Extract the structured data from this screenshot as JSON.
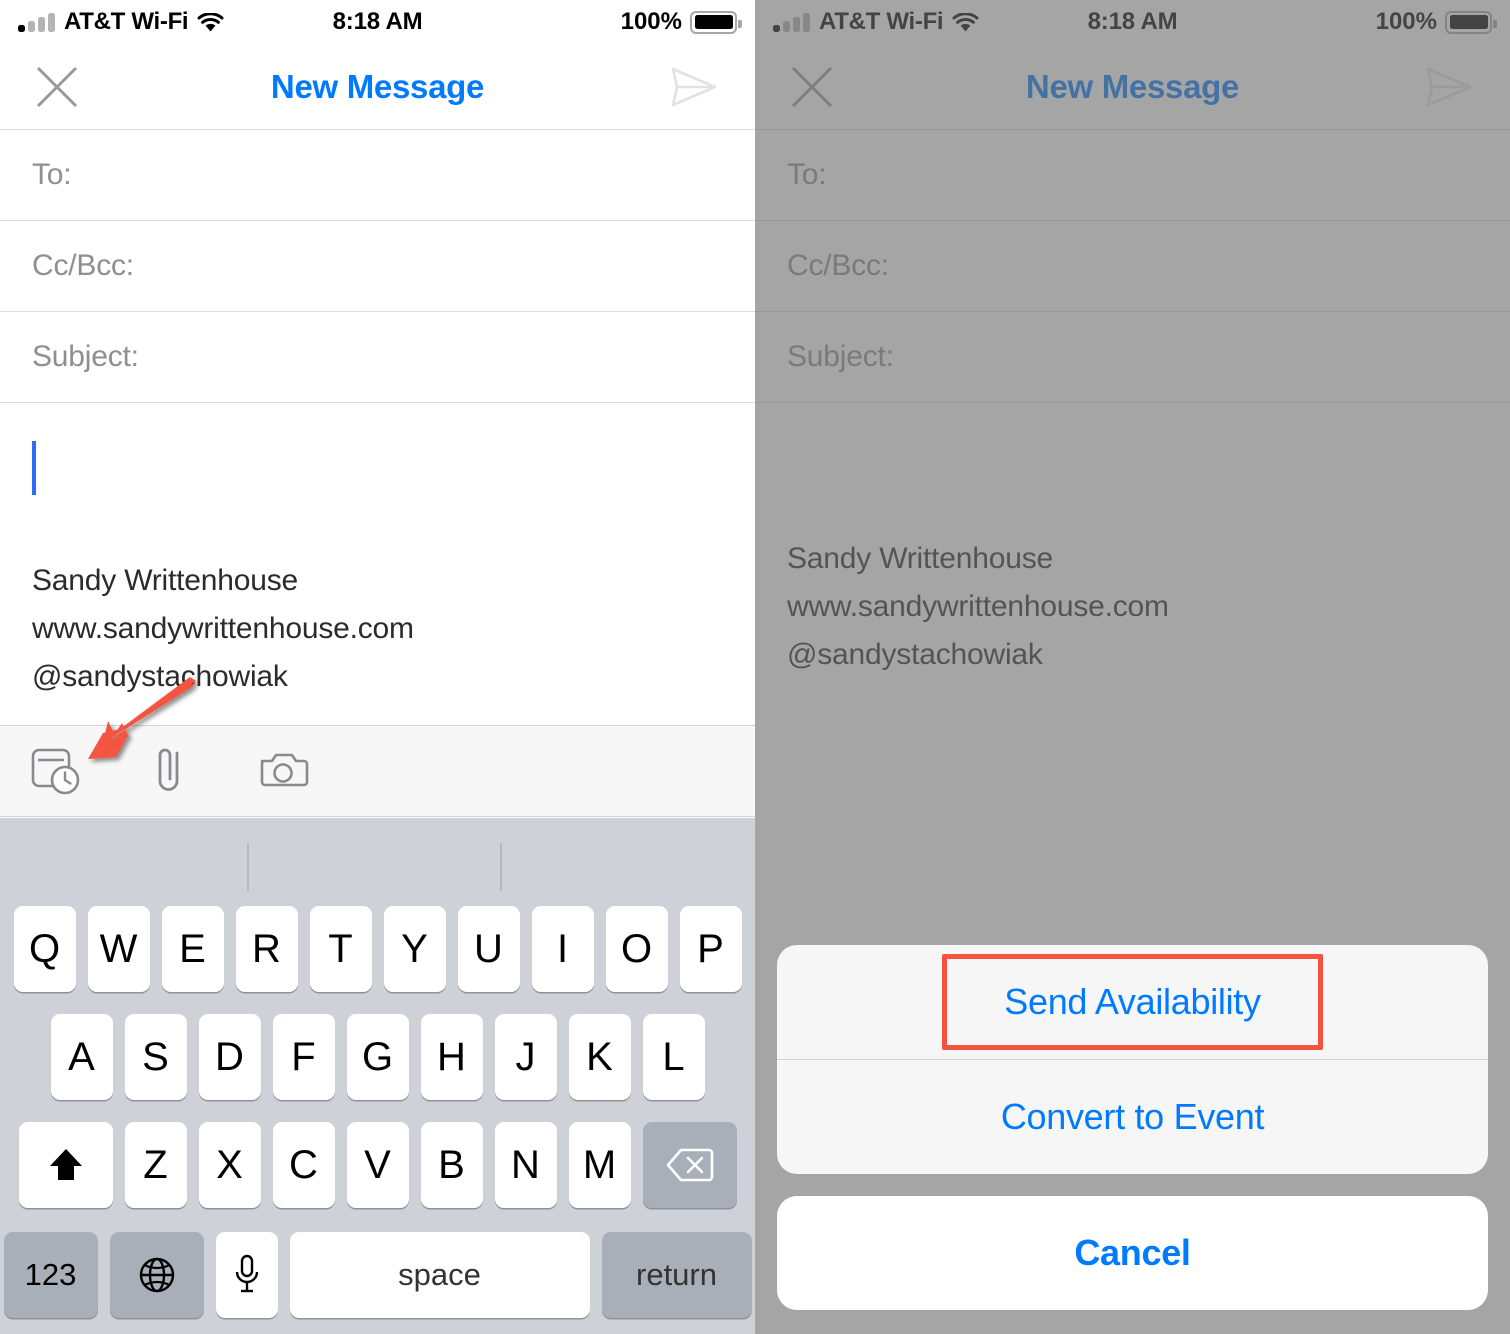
{
  "statusbar": {
    "carrier": "AT&T Wi-Fi",
    "time": "8:18 AM",
    "battery_pct": "100%",
    "signal_icon": "signal-bars-icon",
    "wifi_icon": "wifi-icon",
    "battery_icon": "battery-full-icon"
  },
  "navbar": {
    "title": "New Message",
    "close_icon": "close-x-icon",
    "send_icon": "send-paper-plane-icon",
    "title_color": "#007aff"
  },
  "compose": {
    "to_label": "To:",
    "cc_bcc_label": "Cc/Bcc:",
    "subject_label": "Subject:",
    "body_placeholder": "",
    "signature": [
      "Sandy Writtenhouse",
      "www.sandywrittenhouse.com",
      "@sandystachowiak"
    ]
  },
  "toolbar": {
    "items": [
      {
        "name": "calendar-availability-icon",
        "label": "Calendar Availability"
      },
      {
        "name": "paperclip-attachment-icon",
        "label": "Attach File"
      },
      {
        "name": "camera-icon",
        "label": "Camera"
      }
    ]
  },
  "keyboard": {
    "row1": [
      "Q",
      "W",
      "E",
      "R",
      "T",
      "Y",
      "U",
      "I",
      "O",
      "P"
    ],
    "row2": [
      "A",
      "S",
      "D",
      "F",
      "G",
      "H",
      "J",
      "K",
      "L"
    ],
    "row3": [
      "Z",
      "X",
      "C",
      "V",
      "B",
      "N",
      "M"
    ],
    "shift_icon": "shift-arrow-up-icon",
    "backspace_icon": "backspace-delete-icon",
    "numeric_key": "123",
    "globe_icon": "globe-language-icon",
    "mic_icon": "microphone-dictation-icon",
    "space_key": "space",
    "return_key": "return"
  },
  "action_sheet": {
    "options": [
      "Send Availability",
      "Convert to Event"
    ],
    "cancel": "Cancel",
    "highlighted_option": "Send Availability"
  },
  "annotations": {
    "arrow_color": "#f4543f",
    "arrow_target": "calendar-availability-icon",
    "highlight_color": "#f4543f"
  },
  "colors": {
    "accent_blue": "#007aff",
    "keyboard_bg": "#ced2d8",
    "key_white": "#ffffff",
    "key_dark": "#a9afb8",
    "dim_overlay": "#6e6e6e",
    "placeholder_gray": "#8e8e93"
  }
}
